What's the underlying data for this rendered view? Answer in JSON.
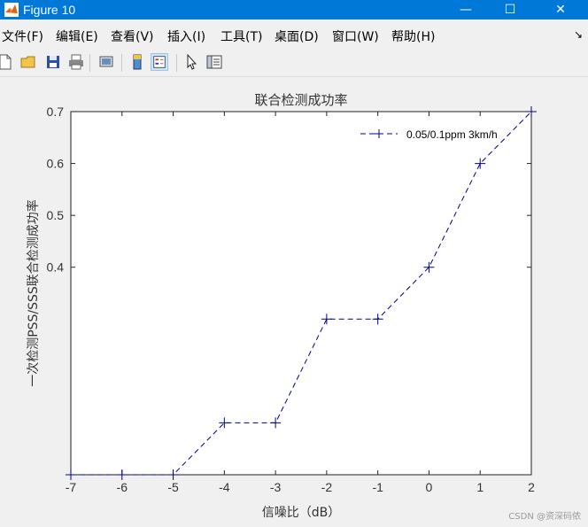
{
  "window": {
    "title": "Figure 10",
    "minimize": "—",
    "maximize": "☐",
    "close": "✕"
  },
  "menu": [
    "文件(F)",
    "编辑(E)",
    "查看(V)",
    "插入(I)",
    "工具(T)",
    "桌面(D)",
    "窗口(W)",
    "帮助(H)"
  ],
  "menu_dock_arrow": "↘",
  "toolbar": [
    {
      "icon": "new-file-icon"
    },
    {
      "icon": "open-folder-icon"
    },
    {
      "icon": "save-icon"
    },
    {
      "icon": "print-icon"
    },
    {
      "icon": "link-plot-icon"
    },
    {
      "icon": "colorbar-icon"
    },
    {
      "icon": "legend-icon"
    },
    {
      "icon": "pointer-icon"
    },
    {
      "icon": "property-editor-icon"
    }
  ],
  "chart_data": {
    "type": "line",
    "title": "联合检测成功率",
    "xlabel": "信噪比（dB）",
    "ylabel": "一次检测PSS/SSS联合检测成功率",
    "x": [
      -7,
      -6,
      -5,
      -4,
      -3,
      -2,
      -1,
      0,
      1,
      2
    ],
    "xlim": [
      -7,
      2
    ],
    "ylim": [
      0,
      0.7
    ],
    "xticks": [
      "-7",
      "-6",
      "-5",
      "-4",
      "-3",
      "-2",
      "-1",
      "0",
      "1",
      "2"
    ],
    "yticks": [
      "0.4",
      "0.5",
      "0.6",
      "0.7"
    ],
    "series": [
      {
        "name": "0.05/0.1ppm 3km/h",
        "color": "#00008b",
        "style": "dashed",
        "marker": "+",
        "values": [
          0,
          0,
          0,
          0.1,
          0.1,
          0.3,
          0.3,
          0.4,
          0.6,
          0.7
        ]
      }
    ],
    "legend": "top-right",
    "grid": false
  },
  "watermark": "CSDN @资深码侬"
}
